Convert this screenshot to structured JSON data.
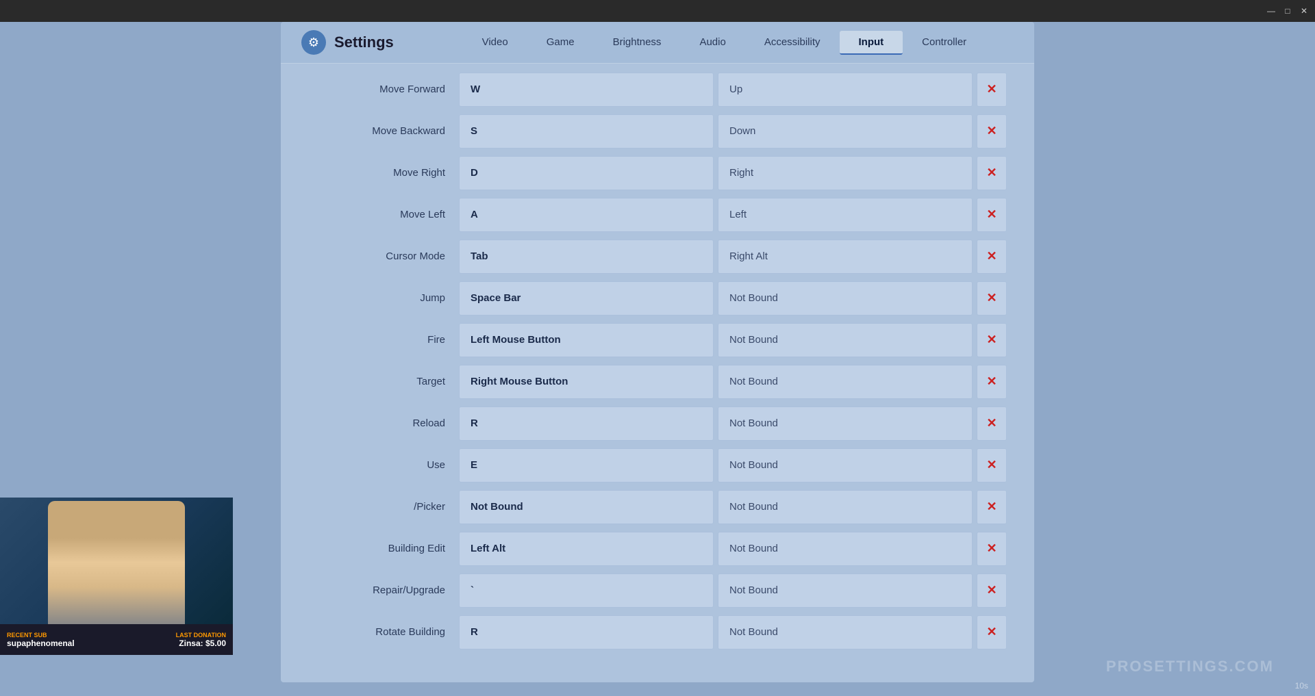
{
  "titleBar": {
    "minimizeLabel": "—",
    "maximizeLabel": "□",
    "closeLabel": "✕"
  },
  "header": {
    "title": "Settings",
    "logoIcon": "⚙",
    "tabs": [
      {
        "id": "video",
        "label": "Video",
        "active": false
      },
      {
        "id": "game",
        "label": "Game",
        "active": false
      },
      {
        "id": "brightness",
        "label": "Brightness",
        "active": false
      },
      {
        "id": "audio",
        "label": "Audio",
        "active": false
      },
      {
        "id": "accessibility",
        "label": "Accessibility",
        "active": false
      },
      {
        "id": "input",
        "label": "Input",
        "active": true
      },
      {
        "id": "controller",
        "label": "Controller",
        "active": false
      }
    ]
  },
  "bindings": [
    {
      "action": "Move Forward",
      "primary": "W",
      "secondary": "Up"
    },
    {
      "action": "Move Backward",
      "primary": "S",
      "secondary": "Down"
    },
    {
      "action": "Move Right",
      "primary": "D",
      "secondary": "Right"
    },
    {
      "action": "Move Left",
      "primary": "A",
      "secondary": "Left"
    },
    {
      "action": "Cursor Mode",
      "primary": "Tab",
      "secondary": "Right Alt"
    },
    {
      "action": "Jump",
      "primary": "Space Bar",
      "secondary": "Not Bound"
    },
    {
      "action": "Fire",
      "primary": "Left Mouse Button",
      "secondary": "Not Bound"
    },
    {
      "action": "Target",
      "primary": "Right Mouse Button",
      "secondary": "Not Bound"
    },
    {
      "action": "Reload",
      "primary": "R",
      "secondary": "Not Bound"
    },
    {
      "action": "Use",
      "primary": "E",
      "secondary": "Not Bound"
    },
    {
      "action": "/Picker",
      "primary": "Not Bound",
      "secondary": "Not Bound"
    },
    {
      "action": "Building Edit",
      "primary": "Left Alt",
      "secondary": "Not Bound"
    },
    {
      "action": "Repair/Upgrade",
      "primary": "`",
      "secondary": "Not Bound"
    },
    {
      "action": "Rotate Building",
      "primary": "R",
      "secondary": "Not Bound"
    }
  ],
  "clearButtonLabel": "✕",
  "webcam": {
    "recentSubLabel": "RECENT SUB",
    "streamerName": "supaphenomenal",
    "lastDonationLabel": "LAST DONATION",
    "donationInfo": "Zinsa: $5.00"
  },
  "watermark": "PROSETTINGS.COM",
  "timer": "10s"
}
